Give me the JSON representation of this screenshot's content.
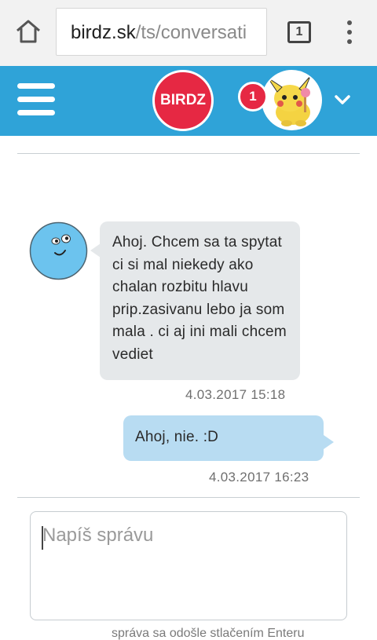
{
  "browser": {
    "url_host": "birdz.sk",
    "url_path": "/ts/conversati",
    "tab_count": "1",
    "icons": [
      "home-icon",
      "tabs-icon",
      "more-vert-icon"
    ]
  },
  "header": {
    "logo_text": "BIRDZ",
    "notification_count": "1",
    "icons": [
      "hamburger-icon",
      "user-avatar",
      "chevron-down-icon"
    ],
    "color": "#2fa3d8",
    "accent": "#e62843"
  },
  "conversation": {
    "messages": [
      {
        "direction": "incoming",
        "text": "Ahoj. Chcem sa ta spytat ci si mal niekedy ako chalan rozbitu hlavu prip.zasivanu lebo ja som mala . ci aj ini mali chcem vediet",
        "time": "4.03.2017 15:18"
      },
      {
        "direction": "outgoing",
        "text": "Ahoj, nie. :D",
        "time": "4.03.2017 16:23"
      }
    ]
  },
  "compose": {
    "placeholder": "Napíš správu",
    "hint": "správa sa odošle stlačením Enteru"
  }
}
